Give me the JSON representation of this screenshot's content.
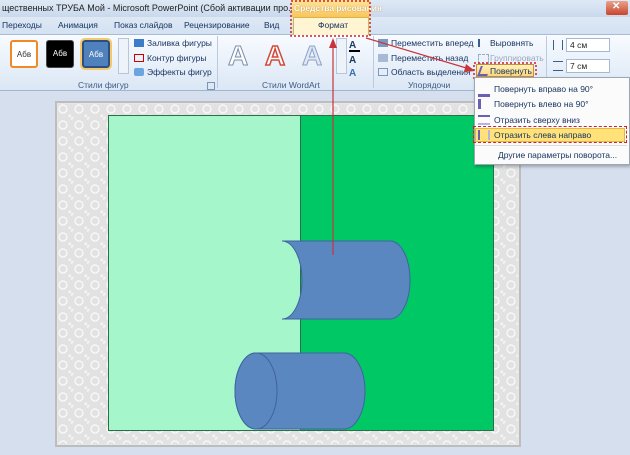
{
  "title": "щественных ТРУБА  Мой  -  Microsoft PowerPoint (Сбой активации про...",
  "contextual_tab_group": "Средства рисования",
  "tabs": [
    "Переходы",
    "Анимация",
    "Показ слайдов",
    "Рецензирование",
    "Вид",
    "Формат"
  ],
  "ribbon": {
    "shape_styles": {
      "samples": [
        "Абв",
        "Абв",
        "Абв"
      ],
      "fill_label": "Заливка фигуры",
      "outline_label": "Контур фигуры",
      "effects_label": "Эффекты фигур",
      "group_label": "Стили фигур"
    },
    "wordart": {
      "samples": [
        "A",
        "A",
        "A"
      ],
      "group_label": "Стили WordArt"
    },
    "arrange": {
      "bring_forward": "Переместить вперед",
      "send_backward": "Переместить назад",
      "selection_pane": "Область выделения",
      "align": "Выровнять",
      "group": "Группировать",
      "rotate": "Повернуть",
      "group_label": "Упорядочи"
    },
    "size": {
      "height": "4 см",
      "width": "7 см"
    }
  },
  "rotate_menu": {
    "items": [
      "Повернуть вправо на 90°",
      "Повернуть влево на 90°",
      "Отразить сверху вниз",
      "Отразить слева направо",
      "Другие параметры поворота..."
    ],
    "highlighted": "Отразить слева направо"
  },
  "colors": {
    "slide_left": "#a5f7cb",
    "slide_right": "#00c864",
    "cylinder": "#5b87c0",
    "highlight": "#ffe27a",
    "annotation": "#d02020"
  }
}
